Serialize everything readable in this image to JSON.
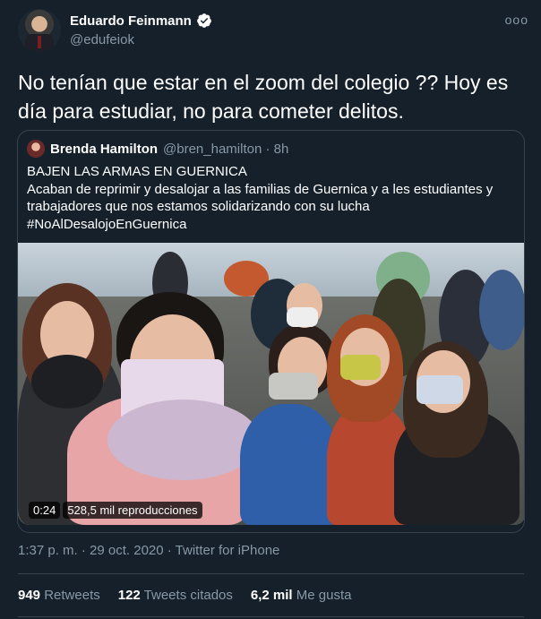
{
  "author": {
    "display_name": "Eduardo Feinmann",
    "handle": "@edufeiok",
    "verified_icon": "verified-badge-icon"
  },
  "more_icon": "more-options-icon",
  "more_glyph": "ooo",
  "tweet": {
    "text": "No tenían que estar en el zoom del colegio ??  Hoy es día para estudiar, no para cometer delitos."
  },
  "quote": {
    "display_name": "Brenda Hamilton",
    "handle_time": "@bren_hamilton · 8h",
    "lines": [
      "BAJEN LAS ARMAS EN GUERNICA",
      "Acaban de reprimir y desalojar a las familias de Guernica y a les estudiantes y trabajadores que nos estamos solidarizando con su lucha",
      "#NoAlDesalojoEnGuernica"
    ],
    "video": {
      "duration": "0:24",
      "views": "528,5 mil reproducciones"
    }
  },
  "meta": "1:37 p. m. · 29 oct. 2020 · Twitter for iPhone",
  "stats": {
    "retweets_count": "949",
    "retweets_label": "Retweets",
    "quotes_count": "122",
    "quotes_label": "Tweets citados",
    "likes_count": "6,2 mil",
    "likes_label": "Me gusta"
  },
  "colors": {
    "background": "#15202b",
    "secondary_text": "#8899a6",
    "border": "#38444d",
    "verified": "#ffffff"
  }
}
